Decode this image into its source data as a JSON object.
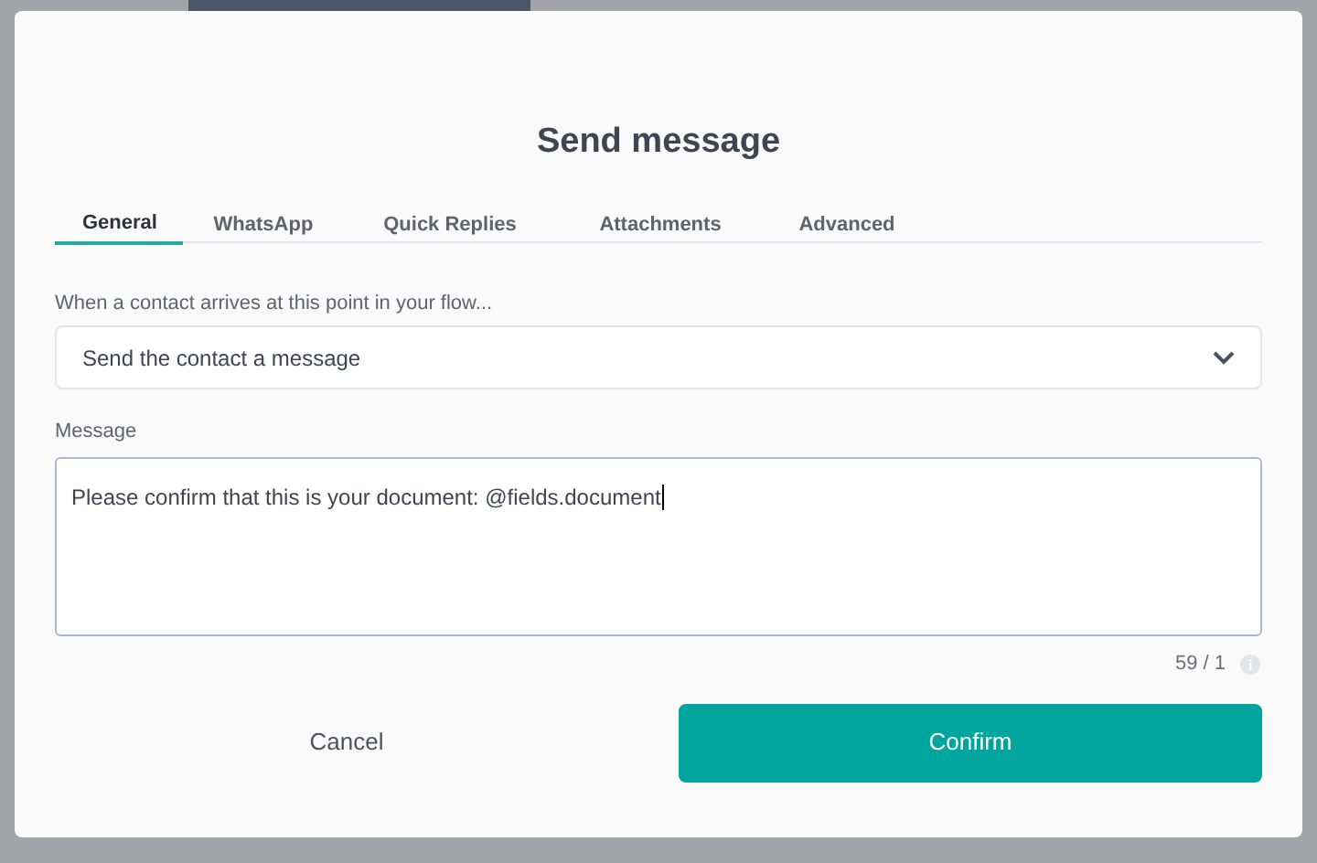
{
  "dialog": {
    "title": "Send message",
    "tabs": [
      {
        "label": "General",
        "selected": true
      },
      {
        "label": "WhatsApp",
        "selected": false
      },
      {
        "label": "Quick Replies",
        "selected": false
      },
      {
        "label": "Attachments",
        "selected": false
      },
      {
        "label": "Advanced",
        "selected": false
      }
    ],
    "action_label": "When a contact arrives at this point in your flow...",
    "action_select": {
      "value": "Send the contact a message"
    },
    "message": {
      "label": "Message",
      "value": "Please confirm that this is your document: @fields.document",
      "counter": "59 / 1"
    },
    "buttons": [
      {
        "label": "Cancel",
        "kind": "secondary"
      },
      {
        "label": "Confirm",
        "kind": "primary"
      }
    ]
  }
}
